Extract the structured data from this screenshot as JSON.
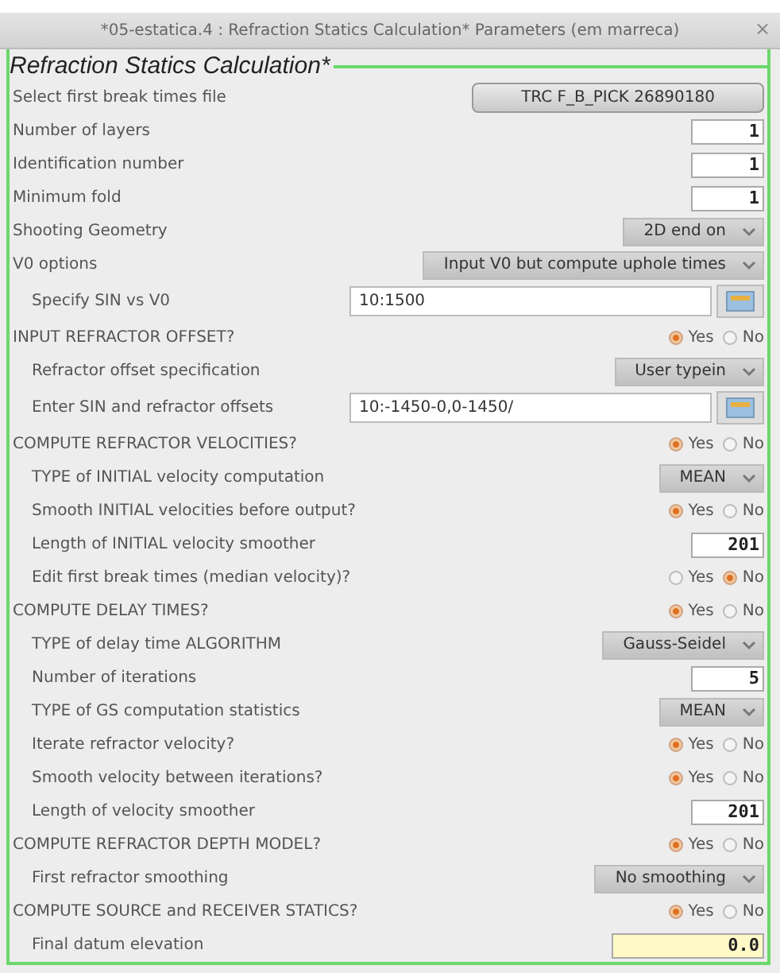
{
  "window": {
    "title": "*05-estatica.4 : Refraction Statics Calculation* Parameters (em marreca)",
    "close": "×"
  },
  "group": {
    "title": "Refraction Statics Calculation*",
    "rows": [
      {
        "kind": "file",
        "label": "Select first break times file",
        "value": "TRC F_B_PICK 26890180"
      },
      {
        "kind": "number",
        "label": "Number of layers",
        "value": "1",
        "highlighted": false
      },
      {
        "kind": "number",
        "label": "Identification number",
        "value": "1",
        "highlighted": false
      },
      {
        "kind": "number",
        "label": "Minimum fold",
        "value": "1",
        "highlighted": false
      },
      {
        "kind": "select",
        "label": "Shooting Geometry",
        "value": "2D end on"
      },
      {
        "kind": "select",
        "label": "V0 options",
        "value": "Input V0 but compute uphole times",
        "children": [
          {
            "kind": "text",
            "label": "Specify SIN vs V0",
            "value": "10:1500"
          }
        ]
      },
      {
        "kind": "radio",
        "label": "INPUT REFRACTOR OFFSET?",
        "options": [
          {
            "label": "Yes",
            "selected": true
          },
          {
            "label": "No",
            "selected": false
          }
        ],
        "children": [
          {
            "kind": "select",
            "label": "Refractor offset specification",
            "value": "User typein"
          },
          {
            "kind": "text",
            "label": "Enter SIN and refractor offsets",
            "value": "10:-1450-0,0-1450/"
          }
        ]
      },
      {
        "kind": "radio",
        "label": "COMPUTE REFRACTOR VELOCITIES?",
        "options": [
          {
            "label": "Yes",
            "selected": true
          },
          {
            "label": "No",
            "selected": false
          }
        ],
        "children": [
          {
            "kind": "select",
            "label": "TYPE of INITIAL velocity computation",
            "value": "MEAN"
          },
          {
            "kind": "radio",
            "label": "Smooth INITIAL velocities before output?",
            "options": [
              {
                "label": "Yes",
                "selected": true
              },
              {
                "label": "No",
                "selected": false
              }
            ]
          },
          {
            "kind": "number",
            "label": "Length of INITIAL velocity smoother",
            "value": "201",
            "highlighted": false
          },
          {
            "kind": "radio",
            "label": "Edit first break times (median velocity)?",
            "options": [
              {
                "label": "Yes",
                "selected": false
              },
              {
                "label": "No",
                "selected": true
              }
            ]
          }
        ]
      },
      {
        "kind": "radio",
        "label": "COMPUTE DELAY TIMES?",
        "options": [
          {
            "label": "Yes",
            "selected": true
          },
          {
            "label": "No",
            "selected": false
          }
        ],
        "children": [
          {
            "kind": "select",
            "label": "TYPE of delay time ALGORITHM",
            "value": "Gauss-Seidel"
          },
          {
            "kind": "number",
            "label": "Number of iterations",
            "value": "5",
            "highlighted": false
          },
          {
            "kind": "select",
            "label": "TYPE of GS computation statistics",
            "value": "MEAN"
          },
          {
            "kind": "radio",
            "label": "Iterate refractor velocity?",
            "options": [
              {
                "label": "Yes",
                "selected": true
              },
              {
                "label": "No",
                "selected": false
              }
            ]
          },
          {
            "kind": "radio",
            "label": "Smooth velocity between iterations?",
            "options": [
              {
                "label": "Yes",
                "selected": true
              },
              {
                "label": "No",
                "selected": false
              }
            ]
          },
          {
            "kind": "number",
            "label": "Length of velocity smoother",
            "value": "201",
            "highlighted": false
          }
        ]
      },
      {
        "kind": "radio",
        "label": "COMPUTE REFRACTOR DEPTH MODEL?",
        "options": [
          {
            "label": "Yes",
            "selected": true
          },
          {
            "label": "No",
            "selected": false
          }
        ],
        "children": [
          {
            "kind": "select",
            "label": "First refractor smoothing",
            "value": "No smoothing"
          }
        ]
      },
      {
        "kind": "radio",
        "label": "COMPUTE SOURCE and RECEIVER STATICS?",
        "options": [
          {
            "label": "Yes",
            "selected": true
          },
          {
            "label": "No",
            "selected": false
          }
        ],
        "children": [
          {
            "kind": "number",
            "label": "Final datum elevation",
            "value": "0.0",
            "highlighted": true
          }
        ]
      }
    ]
  }
}
